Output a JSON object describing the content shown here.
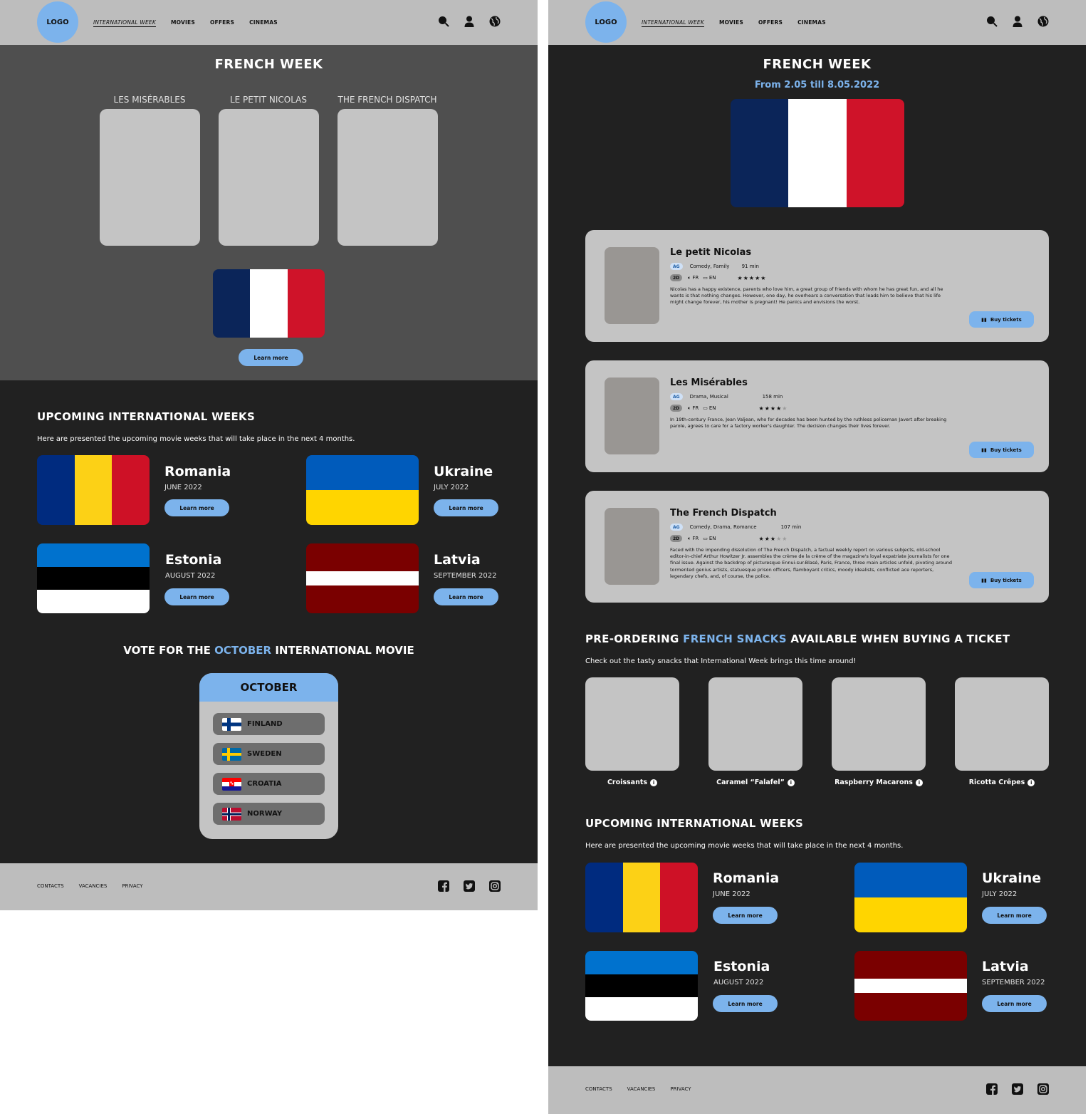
{
  "header": {
    "logo": "LOGO",
    "nav": [
      "INTERNATIONAL WEEK",
      "MOVIES",
      "OFFERS",
      "CINEMAS"
    ],
    "icons": [
      "search-icon",
      "user-icon",
      "globe-icon"
    ]
  },
  "footer": {
    "links": [
      "CONTACTS",
      "VACANCIES",
      "PRIVACY"
    ],
    "icons": [
      "facebook-icon",
      "twitter-icon",
      "instagram-icon"
    ]
  },
  "colors": {
    "accent": "#7cb3ec",
    "header_bg": "#bdbdbd",
    "dark_bg": "#212121",
    "hero_bg": "#4f4f4f",
    "card_bg": "#c4c4c4"
  },
  "page_a": {
    "hero": {
      "title": "FRENCH WEEK",
      "movies": [
        "LES MISÉRABLES",
        "LE PETIT NICOLAS",
        "THE FRENCH DISPATCH"
      ],
      "flag": [
        "#0b2559",
        "#ffffff",
        "#cf1329"
      ],
      "learn_more": "Learn more"
    },
    "vote": {
      "prefix": "VOTE FOR THE",
      "month": "OCTOBER",
      "suffix": "INTERNATIONAL MOVIE",
      "card_title": "OCTOBER",
      "options": [
        "FINLAND",
        "SWEDEN",
        "CROATIA",
        "NORWAY"
      ]
    }
  },
  "page_b": {
    "title": "FRENCH WEEK",
    "dates": "From 2.05 till 8.05.2022",
    "movies": [
      {
        "title": "Le petit Nicolas",
        "age": "AG",
        "genres": "Comedy, Family",
        "duration": "91 min",
        "format": "2D",
        "audio": "FR",
        "subtitles": "EN",
        "rating": 5,
        "description": "Nicolas has a happy existence, parents who love him, a great group of friends with whom he has great fun, and all he wants is that nothing changes. However, one day, he overhears a conversation that leads him to believe that his life might change forever, his mother is pregnant! He panics and envisions the worst.",
        "buy": "Buy tickets"
      },
      {
        "title": "Les Misérables",
        "age": "AG",
        "genres": "Drama, Musical",
        "duration": "158 min",
        "format": "2D",
        "audio": "FR",
        "subtitles": "EN",
        "rating": 4,
        "description": "In 19th-century France, Jean Valjean, who for decades has been hunted by the ruthless policeman Javert after breaking parole, agrees to care for a factory worker's daughter. The decision changes their lives forever.",
        "buy": "Buy tickets"
      },
      {
        "title": "The French Dispatch",
        "age": "AG",
        "genres": "Comedy, Drama, Romance",
        "duration": "107 min",
        "format": "2D",
        "audio": "FR",
        "subtitles": "EN",
        "rating": 3,
        "description": "Faced with the impending dissolution of The French Dispatch, a factual weekly report on various subjects, old-school editor-in-chief Arthur Howitzer Jr. assembles the crème de la crème of the magazine's loyal expatriate journalists for one final issue. Against the backdrop of picturesque Ennui-sur-Blasé, Paris, France, three main articles unfold, pivoting around tormented genius artists, statuesque prison officers, flamboyant critics, moody idealists, conflicted ace reporters, legendary chefs, and, of course, the police.",
        "buy": "Buy tickets"
      }
    ],
    "snacks": {
      "title_prefix": "PRE-ORDERING",
      "title_accent": "FRENCH SNACKS",
      "title_suffix": "AVAILABLE WHEN BUYING A TICKET",
      "subtitle": "Check out the tasty snacks that International Week brings this time around!",
      "items": [
        "Croissants",
        "Caramel “Falafel”",
        "Raspberry Macarons",
        "Ricotta Crêpes"
      ]
    }
  },
  "upcoming": {
    "title": "UPCOMING INTERNATIONAL WEEKS",
    "subtitle": "Here are presented the upcoming movie weeks that will take place in the next 4 months.",
    "learn_more": "Learn more",
    "countries": [
      {
        "name": "Romania",
        "date": "JUNE 2022"
      },
      {
        "name": "Ukraine",
        "date": "JULY 2022"
      },
      {
        "name": "Estonia",
        "date": "AUGUST 2022"
      },
      {
        "name": "Latvia",
        "date": "SEPTEMBER 2022"
      }
    ]
  }
}
